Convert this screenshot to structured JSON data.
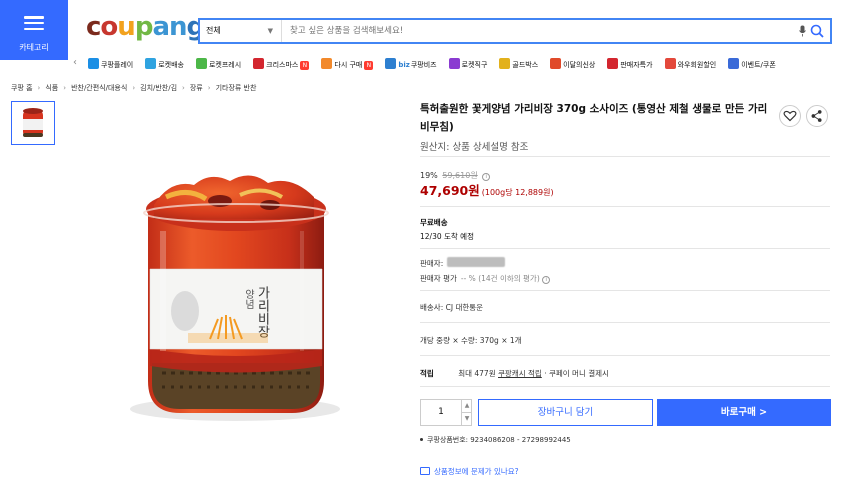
{
  "header": {
    "category_label": "카테고리",
    "logo": [
      "c",
      "o",
      "u",
      "p",
      "a",
      "n",
      "g"
    ],
    "logo_colors": [
      "#7b2a1d",
      "#c7372f",
      "#f2a21e",
      "#72b845",
      "#3c95d3",
      "#3c95d3",
      "#2e73b8"
    ],
    "search_category": "전체",
    "search_placeholder": "찾고 싶은 상품을 검색해보세요!"
  },
  "shortcuts": [
    {
      "label": "쿠팡플레이",
      "icon": "play-icon",
      "color": "#1b8fe5"
    },
    {
      "label": "로켓배송",
      "icon": "rocket-icon",
      "color": "#2fa3e0"
    },
    {
      "label": "로켓프레시",
      "icon": "rocket-fresh-icon",
      "color": "#4cb748"
    },
    {
      "label": "크리스마스",
      "icon": "santa-icon",
      "color": "#d3262f",
      "badge": "N"
    },
    {
      "label": "다시 구매",
      "icon": "repurchase-icon",
      "color": "#f2892b",
      "badge": "N"
    },
    {
      "label": "쿠팡비즈",
      "icon": "biz-icon",
      "color": "#2d7fd0",
      "prefix": "biz"
    },
    {
      "label": "로켓직구",
      "icon": "global-icon",
      "color": "#8a3bd1"
    },
    {
      "label": "골드박스",
      "icon": "goldbox-icon",
      "color": "#e2b11c"
    },
    {
      "label": "이달의신상",
      "icon": "new-icon",
      "color": "#e04a2a"
    },
    {
      "label": "판매자특가",
      "icon": "percent-icon",
      "color": "#d3262f"
    },
    {
      "label": "와우회원할인",
      "icon": "wow-icon",
      "color": "#e3483b"
    },
    {
      "label": "이벤트/쿠폰",
      "icon": "coupon-icon",
      "color": "#3a6ad8"
    }
  ],
  "breadcrumb": [
    "쿠팡 홈",
    "식품",
    "반찬/간편식/대용식",
    "김치/반찬/김",
    "장류",
    "기타장류 반찬"
  ],
  "product": {
    "title": "특허출원한 꽃게양념 가리비장 370g 소사이즈 (통영산 제철 생물로 만든 가리비무침)",
    "origin": "원산지: 상품 상세설명 참조",
    "discount_rate": "19%",
    "original_price": "59,610원",
    "price": "47,690원",
    "unit_price": "(100g당 12,889원)",
    "shipping_title": "무료배송",
    "shipping_eta": "12/30 도착 예정",
    "seller_label": "판매자:",
    "seller_rating_label": "판매자 평가",
    "seller_rating_value": "-- % (14건 이하의 평가)",
    "courier": "배송사: CJ 대한통운",
    "option": "개당 중량 × 수량: 370g × 1개",
    "rewards_label": "적립",
    "rewards_text": "최대 477원",
    "rewards_cash": "쿠팡캐시 적립",
    "rewards_pay": "· 쿠페이 머니 결제시",
    "quantity": "1",
    "cart_button": "장바구니 담기",
    "buy_button": "바로구매 >",
    "product_code": "쿠팡상품번호: 9234086208 - 27298992445",
    "report_link": "상품정보에 문제가 있나요?",
    "jar_label": "가리비장",
    "jar_label_small": "양념"
  }
}
